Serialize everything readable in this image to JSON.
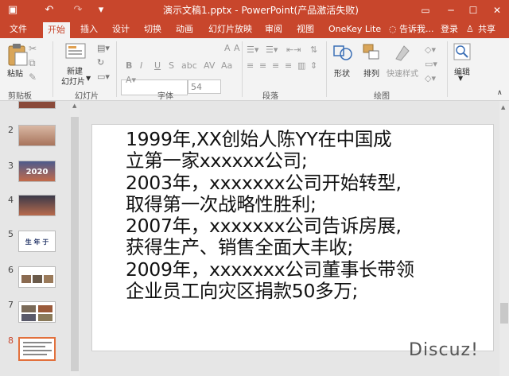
{
  "title_bar": {
    "title": "演示文稿1.pptx - PowerPoint(产品激活失败)"
  },
  "tabs": [
    "文件",
    "开始",
    "插入",
    "设计",
    "切换",
    "动画",
    "幻灯片放映",
    "审阅",
    "视图",
    "OneKey Lite"
  ],
  "tell_me": "告诉我...",
  "signin": "登录",
  "share": "共享",
  "ribbon": {
    "paste": "粘贴",
    "new_slide_line1": "新建",
    "new_slide_line2": "幻灯片",
    "font_size": "54",
    "shape": "形状",
    "arrange": "排列",
    "quick_styles": "快速样式",
    "edit": "编辑",
    "groups": {
      "clipboard": "剪贴板",
      "slides": "幻灯片",
      "font": "字体",
      "paragraph": "段落",
      "drawing": "绘图"
    }
  },
  "thumbnails": [
    {
      "number": "2",
      "text": ""
    },
    {
      "number": "3",
      "text": "2020"
    },
    {
      "number": "4",
      "text": ""
    },
    {
      "number": "5",
      "text": "生 年 于"
    },
    {
      "number": "6",
      "text": ""
    },
    {
      "number": "7",
      "text": ""
    },
    {
      "number": "8",
      "text": ""
    }
  ],
  "slide_lines": [
    "1999年,XX创始人陈YY在中国成",
    "立第一家xxxxxx公司;",
    "2003年，xxxxxxx公司开始转型,",
    "取得第一次战略性胜利;",
    "2007年，xxxxxxx公司告诉房展,",
    "获得生产、销售全面大丰收;",
    "2009年，xxxxxxx公司董事长带领",
    "企业员工向灾区捐款50多万;"
  ],
  "watermark": "Discuz!"
}
